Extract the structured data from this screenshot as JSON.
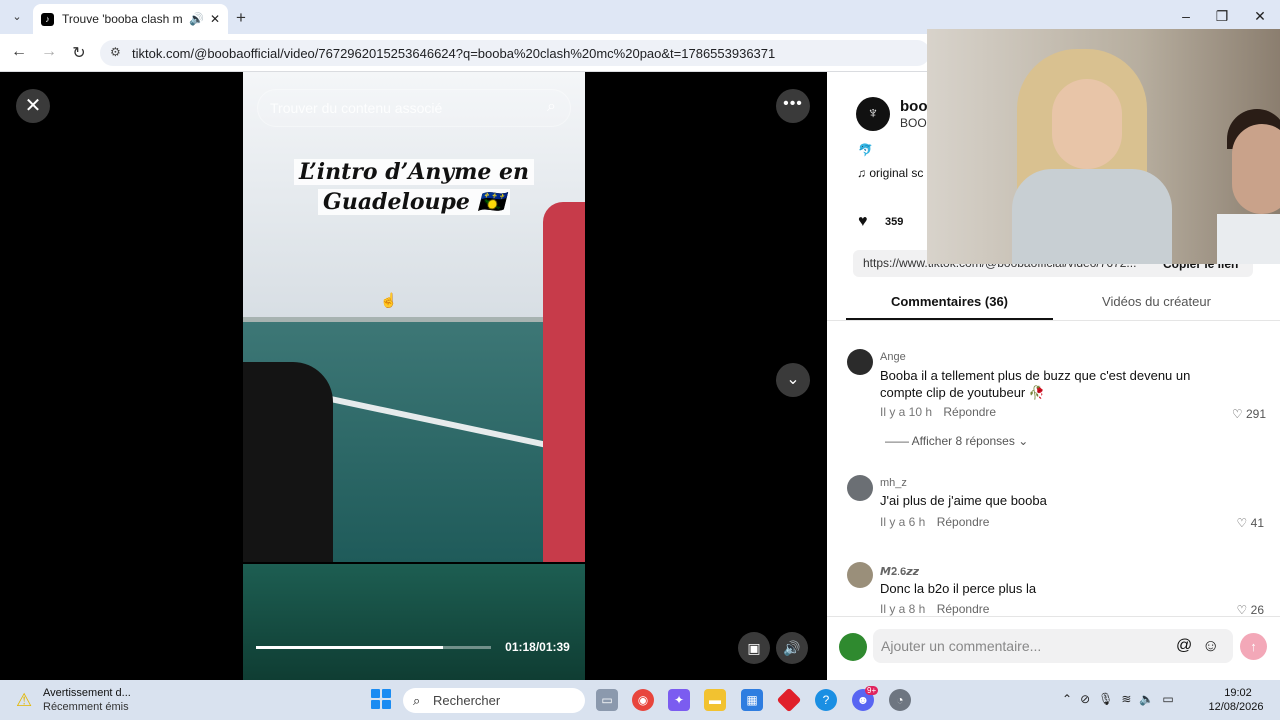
{
  "browser": {
    "tab_title": "Trouve 'booba clash mc pao",
    "tab_favicon": "tiktok-icon",
    "url": "tiktok.com/@boobaofficial/video/7672962015253646624?q=booba%20clash%20mc%20pao&t=1786553936371",
    "new_tab_symbol": "+",
    "close_tab_symbol": "✕"
  },
  "video": {
    "search_placeholder": "Trouver du contenu associé",
    "caption_line1": "L’intro d’Anyme en",
    "caption_line2": "Guadeloupe 🇬🇵",
    "timecode": "01:18/01:39",
    "progress_fraction": 0.795
  },
  "author": {
    "name": "boo",
    "sub": "BOOI",
    "desc_emoji": "🐬",
    "music": "♫  original sc",
    "likes": "359",
    "link": "https://www.tiktok.com/@boobaofficial/video/7672...",
    "copy_link": "Copier le lien"
  },
  "tabs": {
    "comments": "Commentaires (36)",
    "creator_videos": "Vidéos du créateur"
  },
  "comments": [
    {
      "user": "Ange",
      "text": "Booba il a tellement plus de buzz que c'est devenu un compte clip de youtubeur 🥀",
      "time": "Il y a 10 h",
      "reply": "Répondre",
      "likes": "291",
      "avatar_color": "#2b2b2b"
    },
    {
      "user": "mh_z",
      "text": "J'ai plus de j'aime que booba",
      "time": "Il y a 6 h",
      "reply": "Répondre",
      "likes": "41",
      "avatar_color": "#6b6f74"
    },
    {
      "user": "𝙈𝟐.𝟔𝙯𝙯",
      "text": "Donc la b2o il perce plus la",
      "time": "Il y a 8 h",
      "reply": "Répondre",
      "likes": "26",
      "avatar_color": "#9a8f7a"
    }
  ],
  "replies_link": "Afficher 8 réponses",
  "comment_input_placeholder": "Ajouter un commentaire...",
  "taskbar": {
    "notification_title": "Avertissement d...",
    "notification_sub": "Récemment émis",
    "search": "Rechercher",
    "time": "19:02",
    "date": "12/08/2026",
    "discord_badge": "9+"
  },
  "colors": {
    "tiktok_send": "#f3a8b8",
    "windows_blue": "#1b8cf2"
  }
}
